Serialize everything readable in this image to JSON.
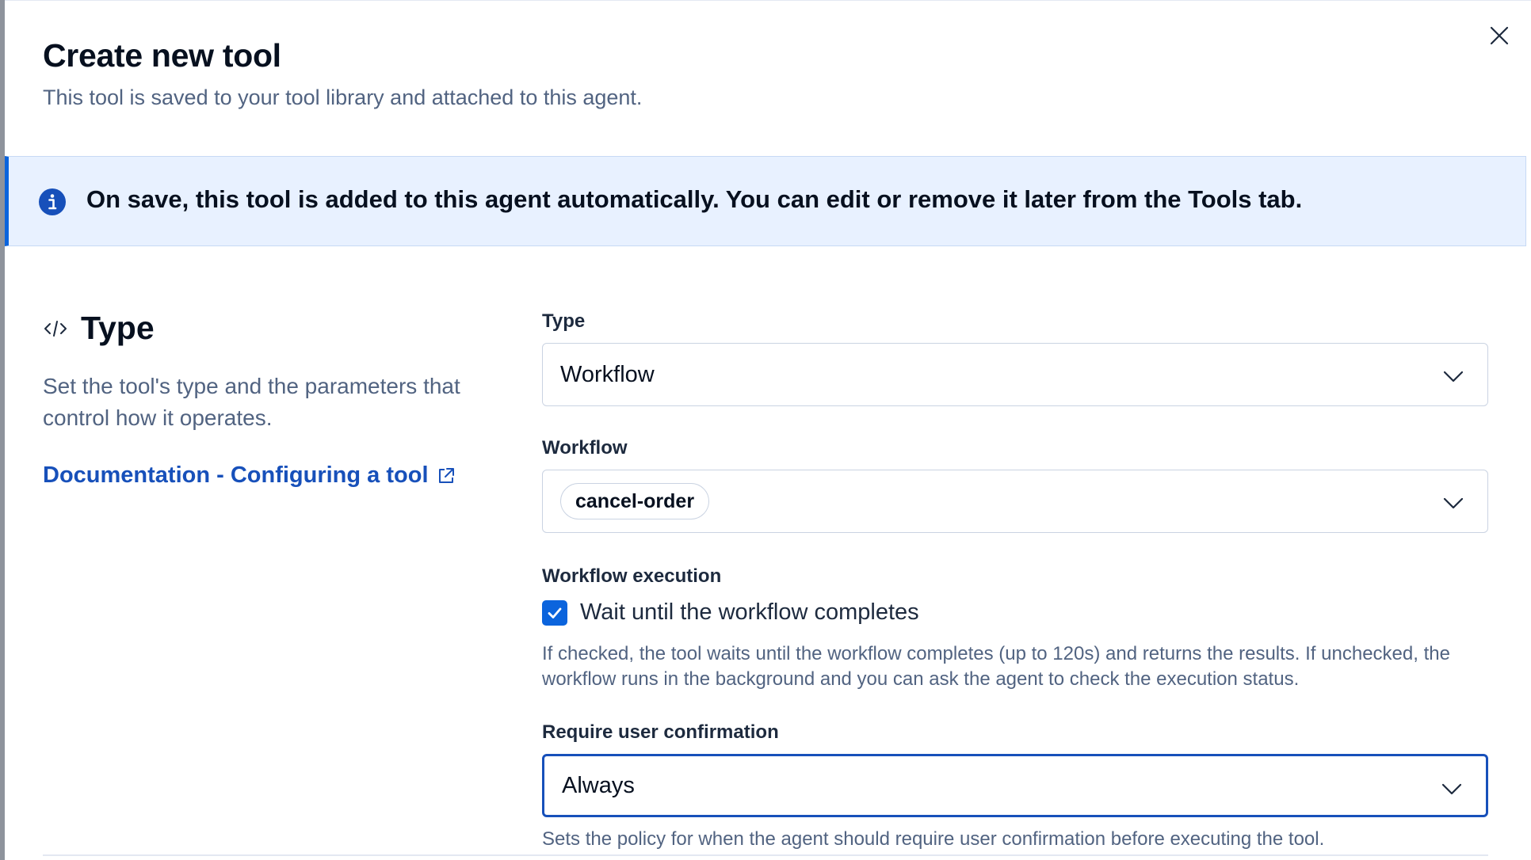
{
  "flyout": {
    "title": "Create new tool",
    "subtitle": "This tool is saved to your tool library and attached to this agent.",
    "close_icon": "close-icon"
  },
  "callout": {
    "icon": "info-icon",
    "text": "On save, this tool is added to this agent automatically. You can edit or remove it later from the Tools tab."
  },
  "type_section": {
    "icon": "code-icon",
    "title": "Type",
    "description": "Set the tool's type and the parameters that control how it operates.",
    "doc_link": "Documentation - Configuring a tool",
    "doc_link_icon": "external-link-icon"
  },
  "form": {
    "type": {
      "label": "Type",
      "value": "Workflow"
    },
    "workflow": {
      "label": "Workflow",
      "value": "cancel-order"
    },
    "execution": {
      "label": "Workflow execution",
      "checkbox_label": "Wait until the workflow completes",
      "checked": true,
      "help": "If checked, the tool waits until the workflow completes (up to 120s) and returns the results. If unchecked, the workflow runs in the background and you can ask the agent to check the execution status."
    },
    "confirmation": {
      "label": "Require user confirmation",
      "value": "Always",
      "help": "Sets the policy for when the agent should require user confirmation before executing the tool."
    }
  },
  "colors": {
    "accent": "#0b64dd",
    "link": "#1750ba",
    "callout_bg": "#e8f1ff",
    "text_primary": "#07101f",
    "text_subdued": "#516381"
  }
}
